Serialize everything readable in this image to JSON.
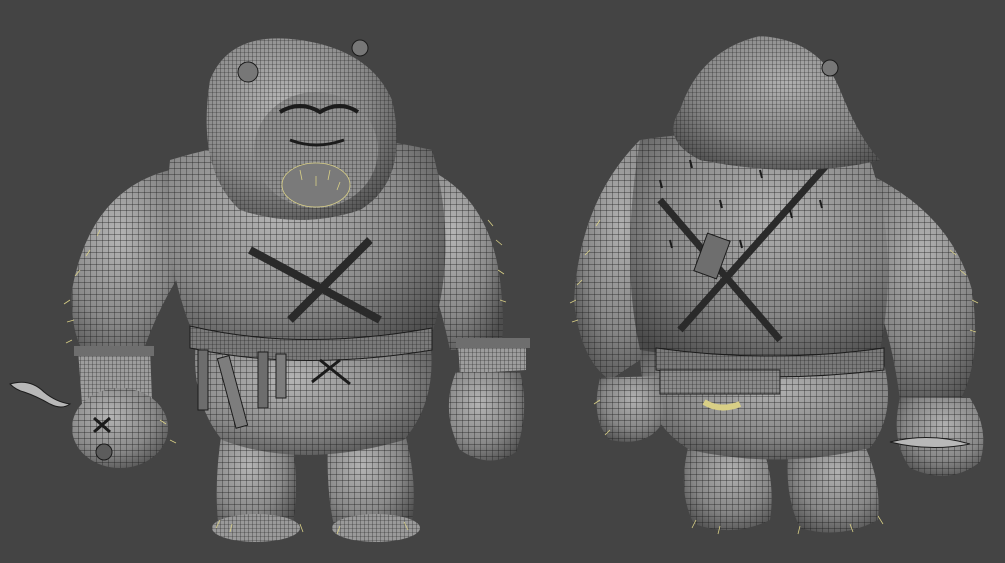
{
  "viewport": {
    "background": "#444444"
  },
  "mesh": {
    "fill": "#8c8c8c",
    "fill_light": "#a9a9a9",
    "fill_dark": "#5e5e5e",
    "wire": "#1b1b1b",
    "fur": "#d8cf86",
    "shadow": "#2e2e2e"
  },
  "views": [
    {
      "name": "front-view"
    },
    {
      "name": "back-view"
    }
  ]
}
